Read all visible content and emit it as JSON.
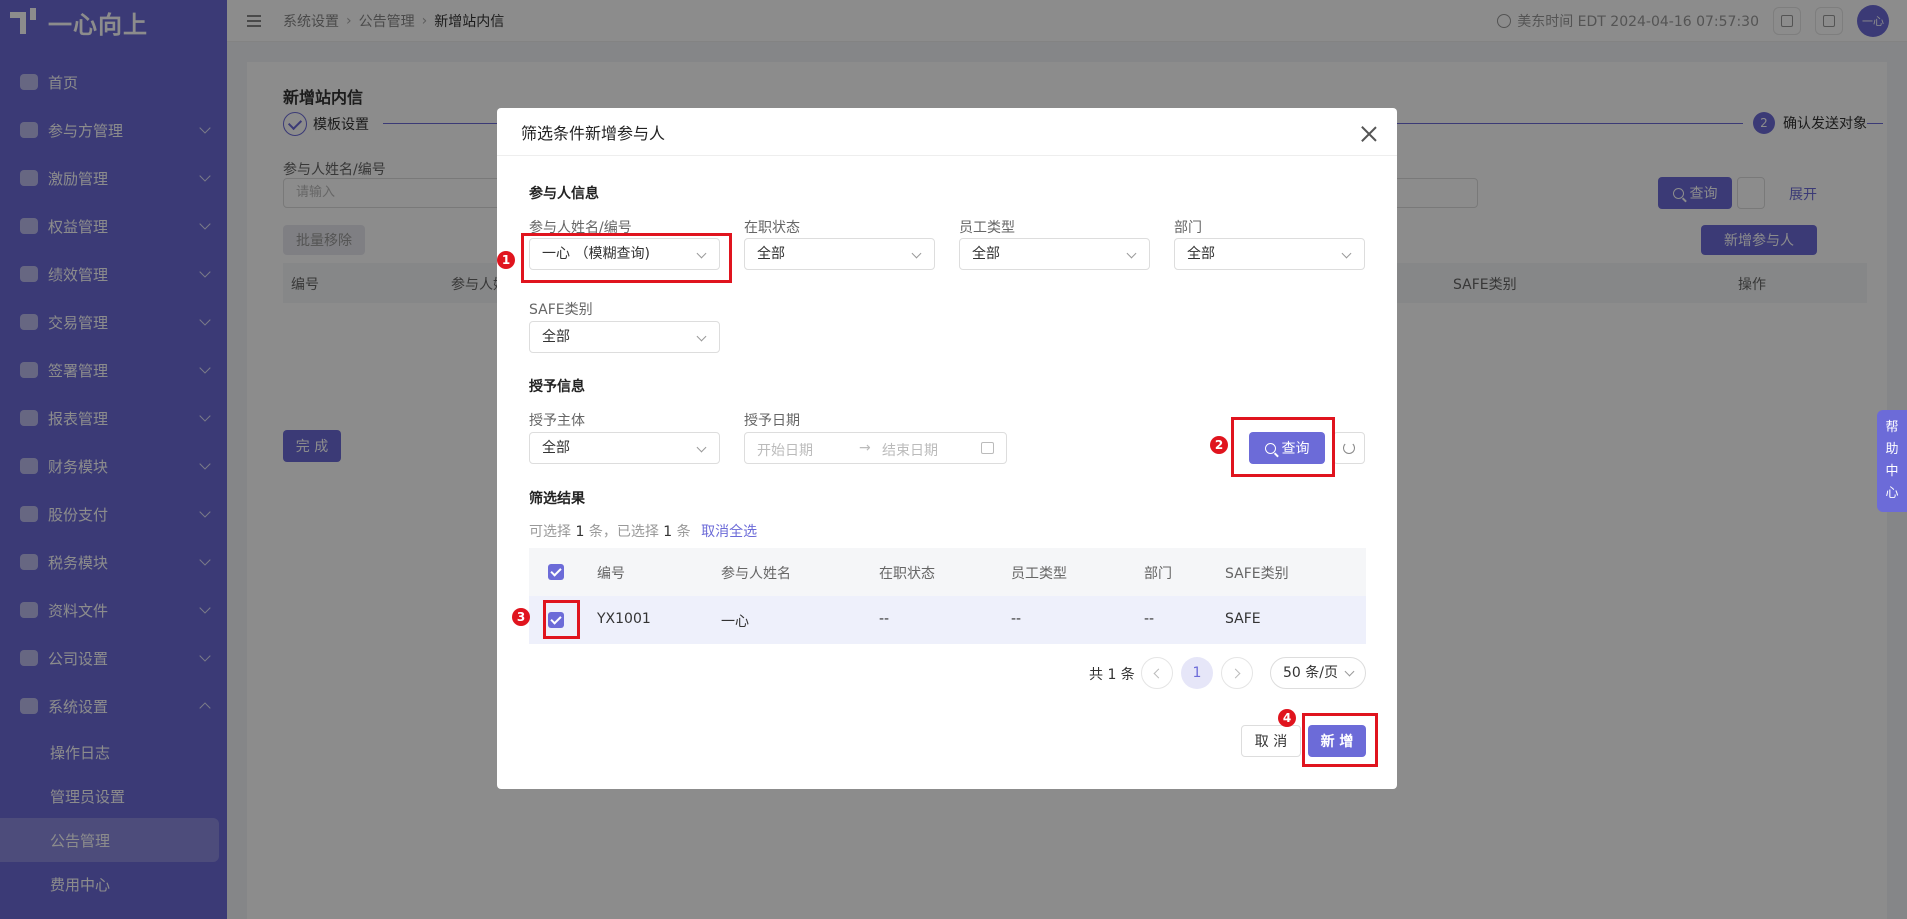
{
  "sidebar": {
    "logo": "一心向上",
    "items": [
      {
        "label": "首页",
        "icon": "home-icon"
      },
      {
        "label": "参与方管理",
        "icon": "users-icon"
      },
      {
        "label": "激励管理",
        "icon": "incentive-icon"
      },
      {
        "label": "权益管理",
        "icon": "equity-icon"
      },
      {
        "label": "绩效管理",
        "icon": "performance-icon"
      },
      {
        "label": "交易管理",
        "icon": "trade-icon"
      },
      {
        "label": "签署管理",
        "icon": "sign-icon"
      },
      {
        "label": "报表管理",
        "icon": "report-icon"
      },
      {
        "label": "财务模块",
        "icon": "finance-icon"
      },
      {
        "label": "股份支付",
        "icon": "share-payment-icon"
      },
      {
        "label": "税务模块",
        "icon": "tax-icon"
      },
      {
        "label": "资料文件",
        "icon": "files-icon"
      },
      {
        "label": "公司设置",
        "icon": "company-icon"
      },
      {
        "label": "系统设置",
        "icon": "system-icon"
      }
    ],
    "sub_items": [
      "操作日志",
      "管理员设置",
      "公告管理",
      "费用中心"
    ],
    "active_sub": "公告管理"
  },
  "header": {
    "breadcrumb": [
      "系统设置",
      "公告管理",
      "新增站内信"
    ],
    "time": "美东时间 EDT 2024-04-16 07:57:30",
    "avatar": "一心"
  },
  "page": {
    "title": "新增站内信",
    "step1": "模板设置",
    "step2_num": "2",
    "step2": "确认发送对象",
    "filter_label": "参与人姓名/编号",
    "filter_placeholder": "请输入",
    "query": "查询",
    "expand": "展开",
    "batch_remove": "批量移除",
    "add_participant": "新增参与人",
    "columns": [
      "编号",
      "参与人姓名",
      "SAFE类别",
      "操作"
    ],
    "finish": "完 成",
    "help": [
      "帮",
      "助",
      "中",
      "心"
    ]
  },
  "modal": {
    "title": "筛选条件新增参与人",
    "participant_section": "参与人信息",
    "fields": {
      "name_label": "参与人姓名/编号",
      "name_value": "一心 （模糊查询)",
      "status_label": "在职状态",
      "status_value": "全部",
      "type_label": "员工类型",
      "type_value": "全部",
      "dept_label": "部门",
      "dept_value": "全部",
      "safe_label": "SAFE类别",
      "safe_value": "全部"
    },
    "grant_section": "授予信息",
    "grant": {
      "subject_label": "授予主体",
      "subject_value": "全部",
      "date_label": "授予日期",
      "start_placeholder": "开始日期",
      "arrow": "→",
      "end_placeholder": "结束日期"
    },
    "query": "查询",
    "result_section": "筛选结果",
    "result_info": {
      "p1": "可选择",
      "selectable": "1",
      "p2": "条，已选择",
      "selected": "1",
      "p3": "条",
      "deselect_all": "取消全选"
    },
    "table": {
      "columns": [
        "编号",
        "参与人姓名",
        "在职状态",
        "员工类型",
        "部门",
        "SAFE类别"
      ],
      "rows": [
        {
          "id": "YX1001",
          "name": "一心",
          "status": "--",
          "type": "--",
          "dept": "--",
          "safe": "SAFE"
        }
      ]
    },
    "pagination": {
      "total": "共 1 条",
      "current": "1",
      "page_size": "50 条/页"
    },
    "cancel": "取 消",
    "confirm": "新 增"
  },
  "annotations": [
    "1",
    "2",
    "3",
    "4"
  ],
  "colors": {
    "accent": "#6c6bd8",
    "highlight": "#e0141e"
  }
}
